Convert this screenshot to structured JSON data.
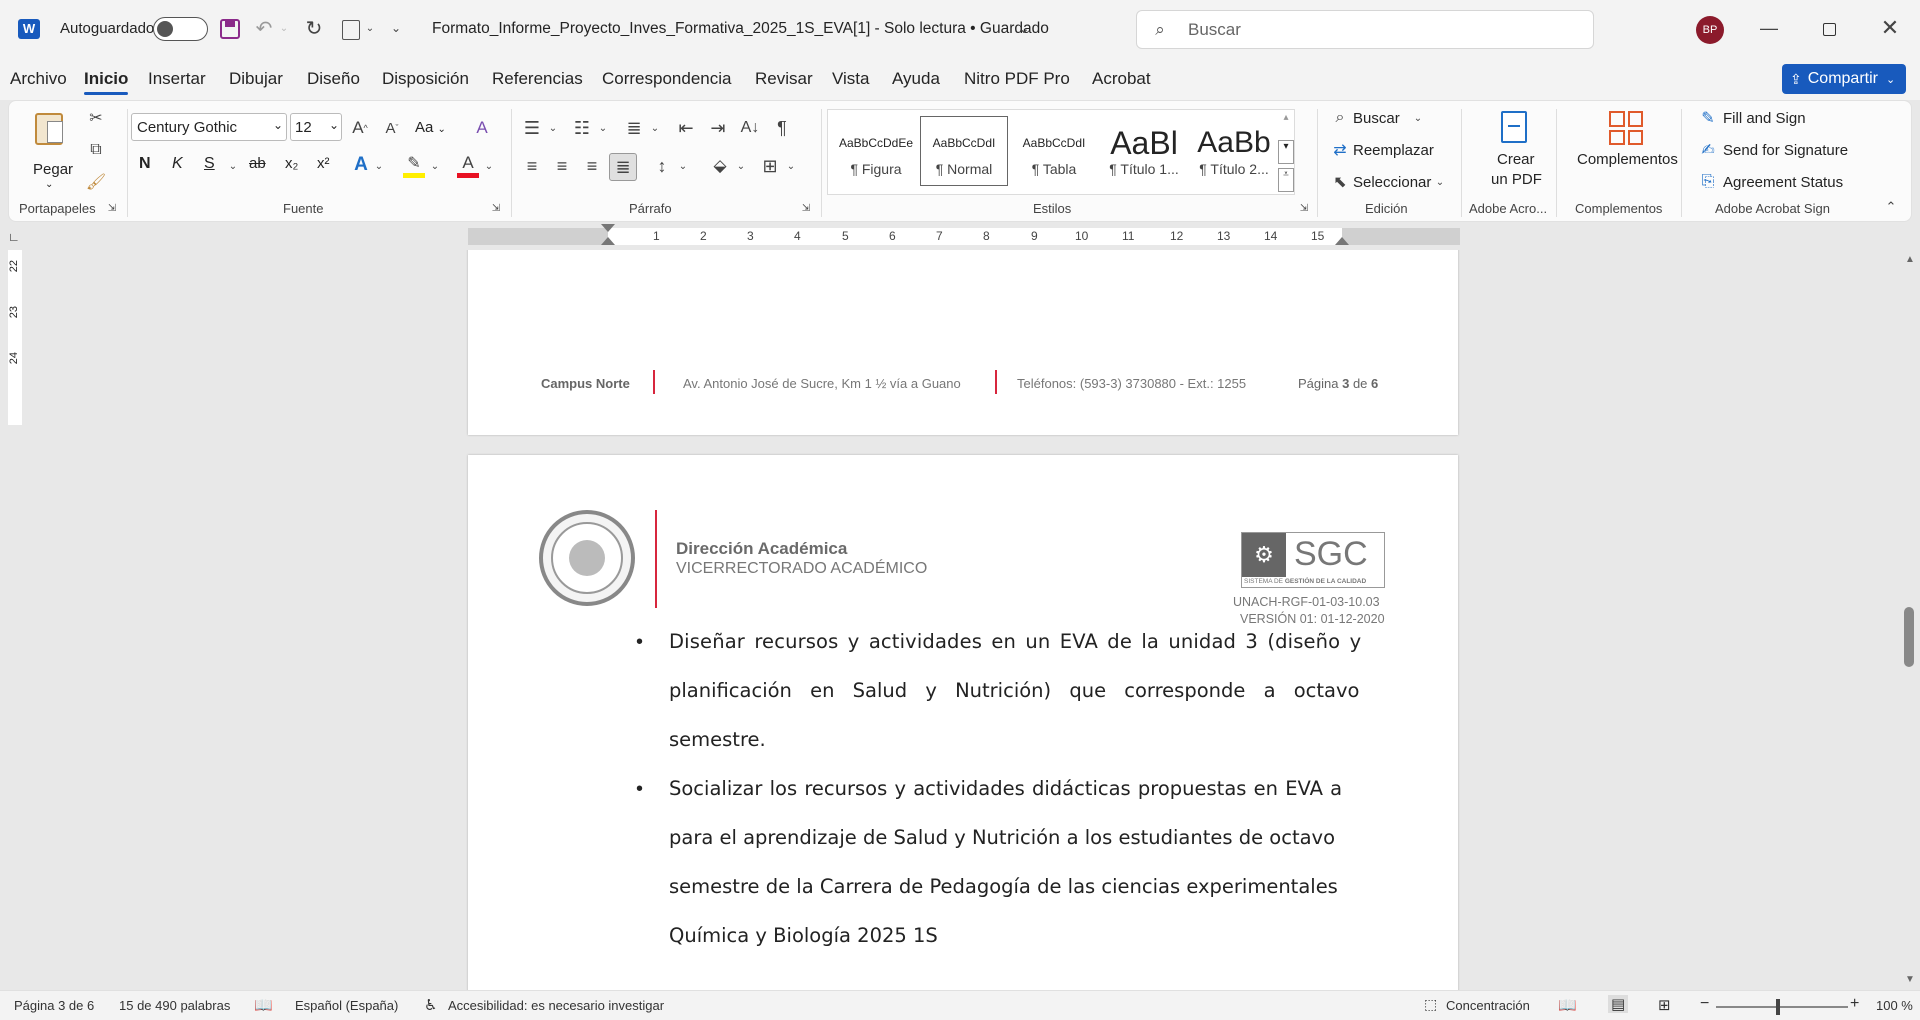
{
  "titlebar": {
    "autosave_label": "Autoguardado",
    "doc_title": "Formato_Informe_Proyecto_Inves_Formativa_2025_1S_EVA[1]  -  Solo lectura • Guardado",
    "search_placeholder": "Buscar",
    "avatar_initials": "BP"
  },
  "tabs": [
    "Archivo",
    "Inicio",
    "Insertar",
    "Dibujar",
    "Diseño",
    "Disposición",
    "Referencias",
    "Correspondencia",
    "Revisar",
    "Vista",
    "Ayuda",
    "Nitro PDF Pro",
    "Acrobat"
  ],
  "share_label": "Compartir",
  "ribbon": {
    "clipboard": {
      "paste_label": "Pegar",
      "group": "Portapapeles"
    },
    "font": {
      "family": "Century Gothic",
      "size": "12",
      "case_label": "Aa",
      "bold": "N",
      "italic": "K",
      "underline": "S",
      "strike": "ab",
      "sub": "x₂",
      "sup": "x²",
      "group": "Fuente"
    },
    "paragraph": {
      "group": "Párrafo"
    },
    "styles": {
      "group": "Estilos",
      "items": [
        {
          "preview": "AaBbCcDdEe",
          "name": "¶ Figura"
        },
        {
          "preview": "AaBbCcDdI",
          "name": "¶ Normal"
        },
        {
          "preview": "AaBbCcDdI",
          "name": "¶ Tabla"
        },
        {
          "preview": "AaBl",
          "name": "¶ Título 1..."
        },
        {
          "preview": "AaBb",
          "name": "¶ Título 2..."
        }
      ]
    },
    "editing": {
      "group": "Edición",
      "find": "Buscar",
      "replace": "Reemplazar",
      "select": "Seleccionar"
    },
    "acrobat": {
      "group": "Adobe Acro...",
      "create_l1": "Crear",
      "create_l2": "un PDF"
    },
    "addins": {
      "group": "Complementos",
      "label": "Complementos"
    },
    "sign": {
      "group": "Adobe Acrobat Sign",
      "fill": "Fill and Sign",
      "send": "Send for Signature",
      "agreement": "Agreement Status"
    }
  },
  "ruler": {
    "top_marks": [
      "1",
      "2",
      "3",
      "4",
      "5",
      "6",
      "7",
      "8",
      "9",
      "10",
      "11",
      "12",
      "13",
      "14",
      "15"
    ],
    "side_marks": [
      "22",
      "23",
      "24"
    ]
  },
  "page3_footer": {
    "campus": "Campus Norte",
    "address": "Av. Antonio José de Sucre, Km 1 ½  vía a Guano",
    "phone": "Teléfonos: (593-3) 3730880 - Ext.: 1255",
    "page_prefix": "Página ",
    "page_num": "3",
    "page_mid": " de ",
    "page_total": "6"
  },
  "page4_header": {
    "dept": "Dirección Académica",
    "subdept": "VICERRECTORADO ACADÉMICO",
    "sgc": "SGC",
    "sgc_caption_1": "SISTEMA DE ",
    "sgc_caption_2": "GESTIÓN DE LA CALIDAD",
    "code": "UNACH-RGF-01-03-10.03",
    "version": "VERSIÓN 01: 01-12-2020"
  },
  "body": {
    "bullet_1": [
      "Diseñar recursos y actividades en un EVA de la unidad 3 (diseño y",
      "planificación en Salud y Nutrición) que corresponde a octavo",
      "semestre."
    ],
    "bullet_2": [
      "Socializar los recursos y actividades didácticas propuestas en EVA a",
      "para el aprendizaje de Salud y Nutrición a los estudiantes de octavo",
      "semestre de la Carrera de Pedagogía de las ciencias experimentales",
      "Química y Biología 2025 1S"
    ]
  },
  "status": {
    "page": "Página 3 de 6",
    "words": "15 de 490 palabras",
    "language": "Español (España)",
    "accessibility": "Accesibilidad: es necesario investigar",
    "focus": "Concentración",
    "zoom": "100 %"
  },
  "colors": {
    "accent": "#185abd",
    "word_blue": "#185abd",
    "avatar": "#8b1a2b",
    "unach_red": "#d7263d"
  }
}
